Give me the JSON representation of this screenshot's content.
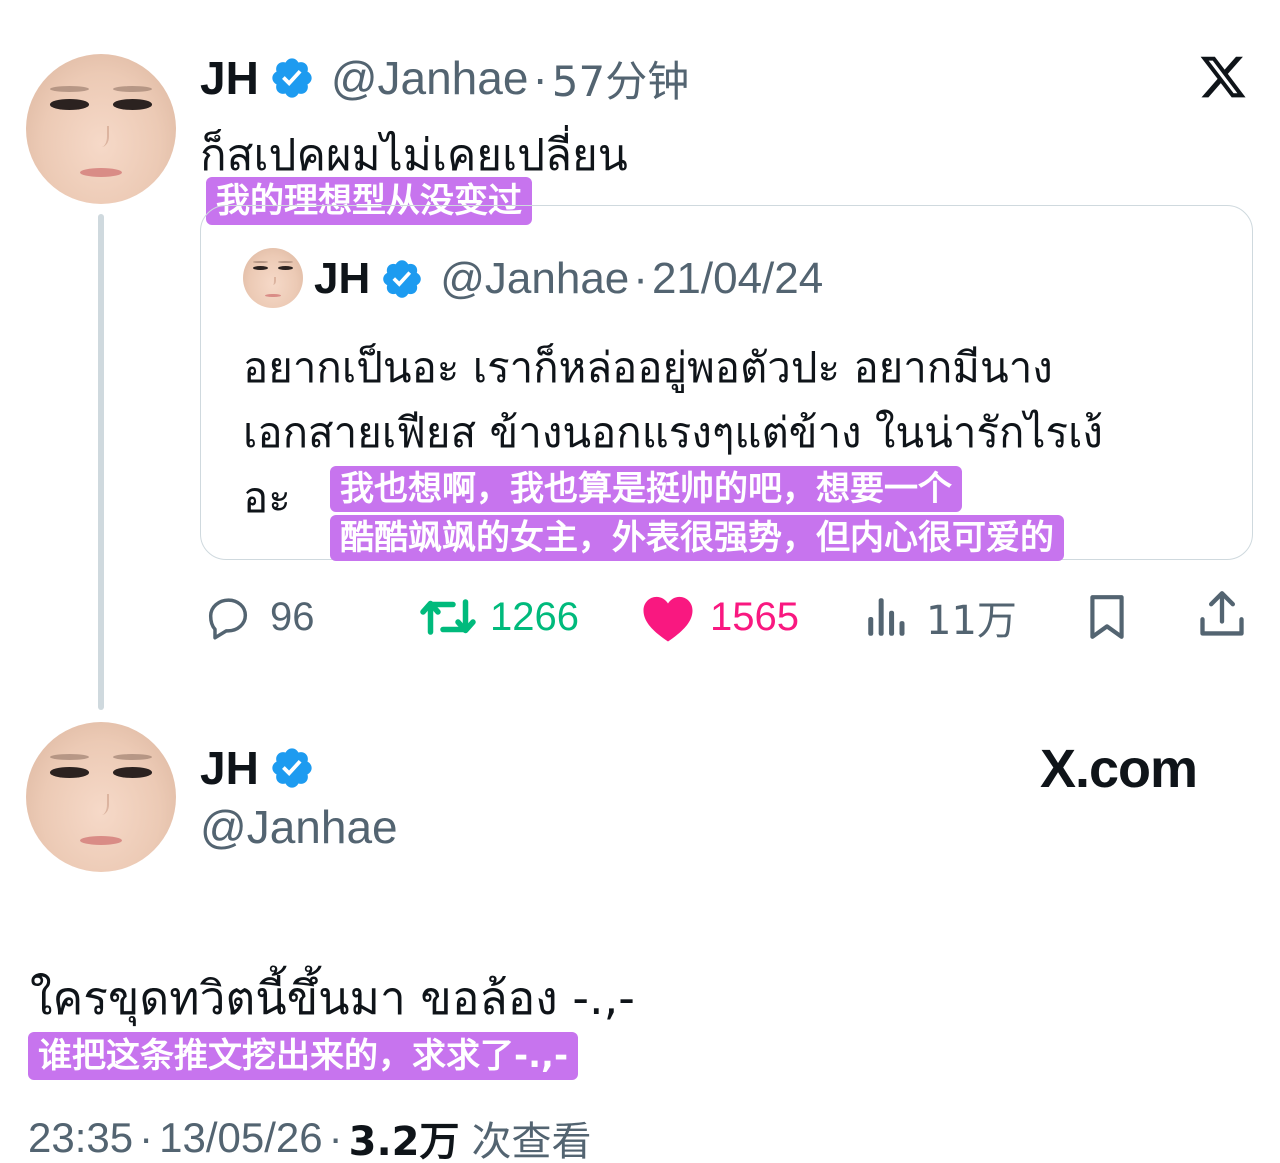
{
  "tweet": {
    "name": "JH",
    "handle": "@Janhae",
    "separator": "·",
    "time": "57分钟",
    "text": "ก็สเปคผมไม่เคยเปลี่ยน",
    "translation": "我的理想型从没变过",
    "brand_icon": "x-logo-icon",
    "quote": {
      "name": "JH",
      "handle": "@Janhae",
      "date": "21/04/24",
      "text_line1": "อยากเป็นอะ เราก็หล่ออยู่พอตัวปะ อยากมีนาง",
      "text_line2": "เอกสายเฟียส ข้างนอกแรงๆแต่ข้าง ในน่ารักไรเง้",
      "text_line3": "อะ",
      "translation_line1": "我也想啊，我也算是挺帅的吧，想要一个",
      "translation_line2": "酷酷飒飒的女主，外表很强势，但内心很可爱的"
    },
    "actions": {
      "replies": "96",
      "retweets": "1266",
      "likes": "1565",
      "views": "11万"
    }
  },
  "detail": {
    "name": "JH",
    "handle": "@Janhae",
    "brand": "X.com",
    "text": "ใครขุดทวิตนี้ขึ้นมา ขอล้อง -.,-",
    "translation": "谁把这条推文挖出来的，求求了-.,-",
    "time": "23:35",
    "date": "13/05/26",
    "views_count": "3.2万",
    "views_label": "次查看"
  },
  "colors": {
    "verified": "#1d9bf0",
    "retweet": "#00ba7c",
    "like": "#f91880",
    "highlight": "#c774ee",
    "secondary_text": "#536471"
  }
}
